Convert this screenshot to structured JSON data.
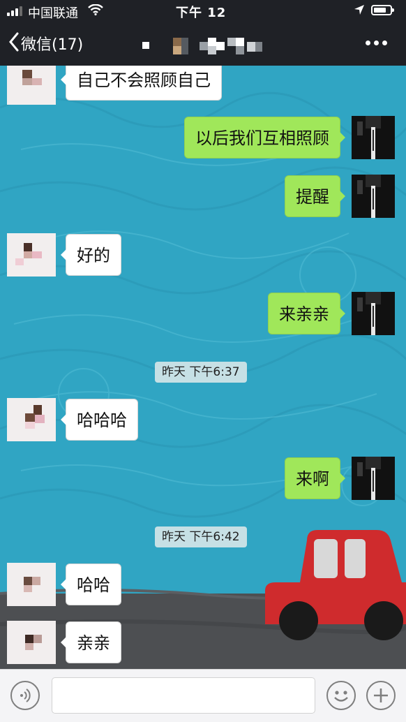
{
  "status_bar": {
    "carrier": "中国联通",
    "time": "下午 12"
  },
  "nav": {
    "back_label": "微信(17)",
    "title": "",
    "more_icon": "more-dots-icon"
  },
  "messages": [
    {
      "side": "in",
      "text": "自己不会照顾自己"
    },
    {
      "side": "out",
      "text": "以后我们互相照顾"
    },
    {
      "side": "out",
      "text": "提醒"
    },
    {
      "side": "in",
      "text": "好的"
    },
    {
      "side": "out",
      "text": "来亲亲"
    },
    {
      "type": "time",
      "text": "昨天 下午6:37"
    },
    {
      "side": "in",
      "text": "哈哈哈"
    },
    {
      "side": "out",
      "text": "来啊"
    },
    {
      "type": "time",
      "text": "昨天 下午6:42"
    },
    {
      "side": "in",
      "text": "哈哈"
    },
    {
      "side": "in",
      "text": "亲亲"
    }
  ],
  "input_bar": {
    "voice_icon": "voice-icon",
    "emoji_icon": "emoji-icon",
    "add_icon": "plus-icon",
    "placeholder": ""
  },
  "colors": {
    "chat_background": "#30a5c3",
    "outgoing_bubble": "#a0e75a",
    "incoming_bubble": "#ffffff",
    "car": "#cf2b2d"
  }
}
